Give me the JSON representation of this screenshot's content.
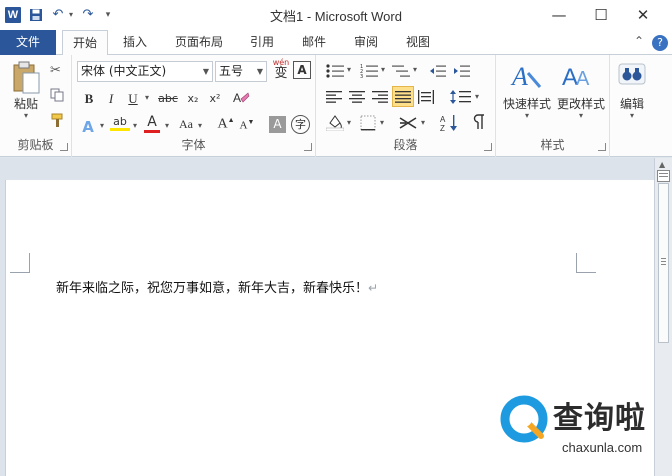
{
  "window": {
    "title": "文档1 - Microsoft Word",
    "app_icon": "W",
    "min_icon": "minimize-icon",
    "max_icon": "maximize-icon",
    "close_icon": "close-icon"
  },
  "tabs": {
    "file": "文件",
    "items": [
      "开始",
      "插入",
      "页面布局",
      "引用",
      "邮件",
      "审阅",
      "视图"
    ],
    "active": "开始"
  },
  "ribbon": {
    "clipboard": {
      "label": "剪贴板",
      "paste": "粘贴"
    },
    "font": {
      "label": "字体",
      "font_name": "宋体 (中文正文)",
      "font_size": "五号",
      "wen": "wén",
      "wen_char": "变",
      "frame_a": "A",
      "bold": "B",
      "italic": "I",
      "underline": "U",
      "strike": "abc",
      "sub": "x₂",
      "sup": "x²",
      "text_effect": "A",
      "highlight": "ab",
      "font_color": "A",
      "case": "Aa",
      "grow": "A",
      "shrink": "A",
      "shade": "A",
      "enclose": "字"
    },
    "paragraph": {
      "label": "段落"
    },
    "styles": {
      "label": "样式",
      "quick": "快速样式",
      "change": "更改样式"
    },
    "editing": {
      "label": "编辑"
    }
  },
  "document": {
    "text": "新年来临之际，祝您万事如意，新年大吉，新春快乐！"
  },
  "watermark": {
    "cn": "查询啦",
    "en": "chaxunla.com"
  },
  "colors": {
    "accent": "#2b579a",
    "highlight_yellow": "#ffe08a",
    "font_red": "#e02020"
  }
}
